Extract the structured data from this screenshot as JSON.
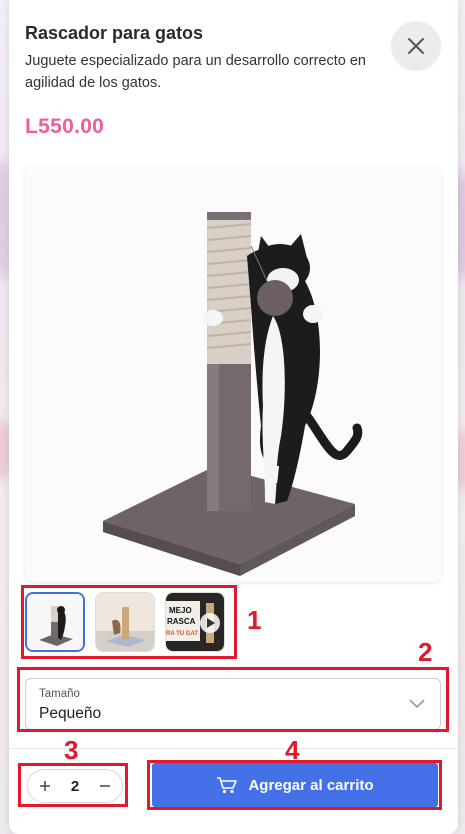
{
  "product": {
    "title": "Rascador para gatos",
    "description": "Juguete especializado para un desarrollo correcto en agilidad de los gatos.",
    "price": "L550.00"
  },
  "thumbnails": [
    {
      "kind": "image",
      "icon": "cat-tree-thumb",
      "selected": true
    },
    {
      "kind": "image",
      "icon": "cat-tree-room-thumb",
      "selected": false
    },
    {
      "kind": "video",
      "icon": "video-thumb",
      "selected": false,
      "caption_lines": [
        "MEJO",
        "RASCA",
        "RA TU GAT"
      ]
    }
  ],
  "size_select": {
    "label": "Tamaño",
    "value": "Pequeño"
  },
  "quantity": {
    "value": "2",
    "increment_symbol": "+",
    "decrement_symbol": "—"
  },
  "cart_button": {
    "label": "Agregar al carrito",
    "icon": "cart-icon",
    "color": "#4471e8"
  },
  "annotations": [
    "1",
    "2",
    "3",
    "4"
  ],
  "colors": {
    "price": "#ec5f9c",
    "accent": "#4471e8",
    "annotation": "#e0192d"
  }
}
